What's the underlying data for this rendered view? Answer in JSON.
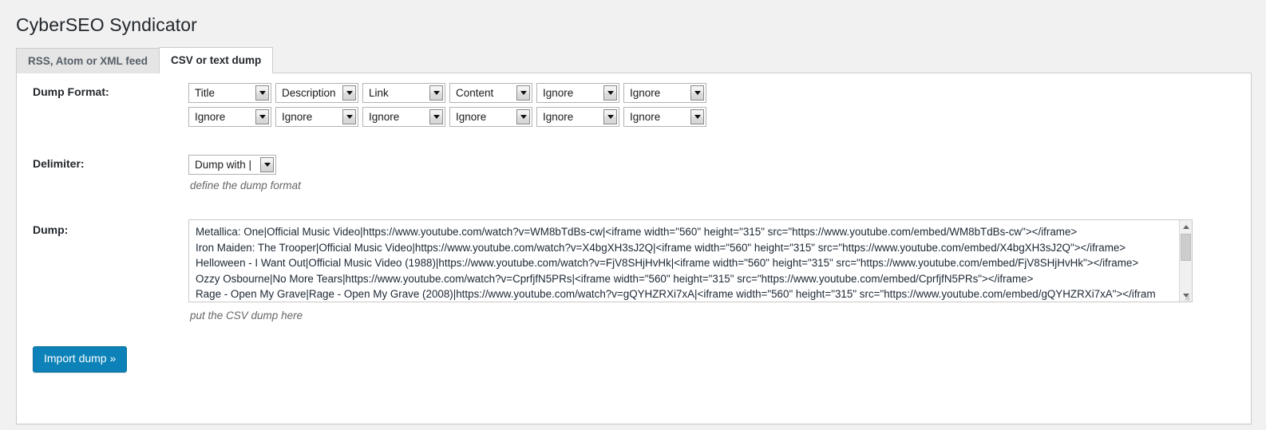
{
  "page": {
    "title": "CyberSEO Syndicator"
  },
  "tabs": [
    {
      "label": "RSS, Atom or XML feed",
      "active": false
    },
    {
      "label": "CSV or text dump",
      "active": true
    }
  ],
  "form": {
    "dump_format": {
      "label": "Dump Format:",
      "row1": [
        "Title",
        "Description",
        "Link",
        "Content",
        "Ignore",
        "Ignore"
      ],
      "row2": [
        "Ignore",
        "Ignore",
        "Ignore",
        "Ignore",
        "Ignore",
        "Ignore"
      ],
      "options": [
        "Ignore",
        "Title",
        "Description",
        "Link",
        "Content"
      ]
    },
    "delimiter": {
      "label": "Delimiter:",
      "value": "Dump with |",
      "hint": "define the dump format"
    },
    "dump": {
      "label": "Dump:",
      "hint": "put the CSV dump here",
      "placeholder": "",
      "lines": [
        "Metallica: One|Official Music Video|https://www.youtube.com/watch?v=WM8bTdBs-cw|<iframe width=\"560\" height=\"315\" src=\"https://www.youtube.com/embed/WM8bTdBs-cw\"></iframe>",
        "Iron Maiden: The Trooper|Official Music Video|https://www.youtube.com/watch?v=X4bgXH3sJ2Q|<iframe width=\"560\" height=\"315\" src=\"https://www.youtube.com/embed/X4bgXH3sJ2Q\"></iframe>",
        "Helloween - I Want Out|Official Music Video (1988)|https://www.youtube.com/watch?v=FjV8SHjHvHk|<iframe width=\"560\" height=\"315\" src=\"https://www.youtube.com/embed/FjV8SHjHvHk\"></iframe>",
        "Ozzy Osbourne|No More Tears|https://www.youtube.com/watch?v=CprfjfN5PRs|<iframe width=\"560\" height=\"315\" src=\"https://www.youtube.com/embed/CprfjfN5PRs\"></iframe>",
        "Rage - Open My Grave|Rage - Open My Grave (2008)|https://www.youtube.com/watch?v=gQYHZRXi7xA|<iframe width=\"560\" height=\"315\" src=\"https://www.youtube.com/embed/gQYHZRXi7xA\"></ifram"
      ]
    }
  },
  "submit": {
    "label": "Import dump »"
  },
  "colors": {
    "page_background": "#f1f1f1",
    "panel_background": "#ffffff",
    "border": "#cccccc",
    "accent_button": "#0c82b8",
    "text_primary": "#23282d",
    "text_hint": "#666666",
    "textarea_text": "#1c2733"
  },
  "icons": {
    "select_chevron": "chevron-down-icon",
    "scroll_up": "scroll-up-arrow-icon",
    "scroll_down": "scroll-down-arrow-icon",
    "resize": "resize-grip-icon"
  }
}
